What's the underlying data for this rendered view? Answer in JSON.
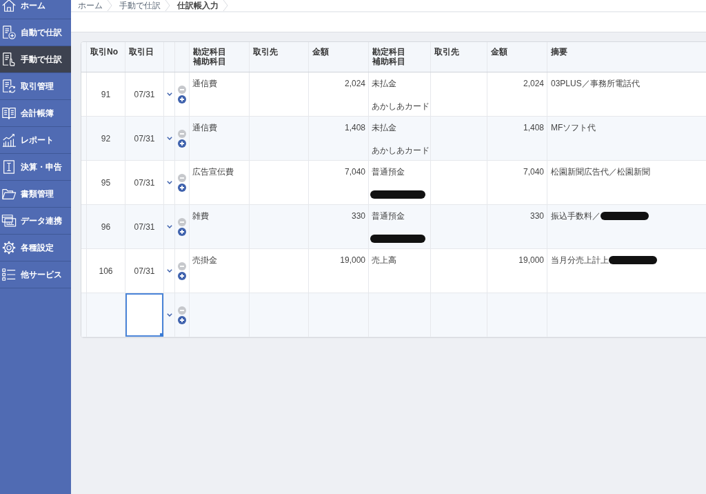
{
  "sidebar": {
    "items": [
      {
        "label": "ホーム",
        "selected": false
      },
      {
        "label": "自動で仕訳",
        "selected": false
      },
      {
        "label": "手動で仕訳",
        "selected": true
      },
      {
        "label": "取引管理",
        "selected": false
      },
      {
        "label": "会計帳簿",
        "selected": false
      },
      {
        "label": "レポート",
        "selected": false
      },
      {
        "label": "決算・申告",
        "selected": false
      },
      {
        "label": "書類管理",
        "selected": false
      },
      {
        "label": "データ連携",
        "selected": false
      },
      {
        "label": "各種設定",
        "selected": false
      },
      {
        "label": "他サービス",
        "selected": false
      }
    ]
  },
  "breadcrumb": [
    {
      "label": "ホーム",
      "current": false
    },
    {
      "label": "手動で仕訳",
      "current": false
    },
    {
      "label": "仕訳帳入力",
      "current": true
    }
  ],
  "table": {
    "columns": [
      {
        "label": "取引No"
      },
      {
        "label": "取引日"
      },
      {
        "label": "勘定科目",
        "sublabel": "補助科目"
      },
      {
        "label": "取引先"
      },
      {
        "label": "金額"
      },
      {
        "label": "勘定科目",
        "sublabel": "補助科目"
      },
      {
        "label": "取引先"
      },
      {
        "label": "金額"
      },
      {
        "label": "摘要"
      }
    ],
    "rows": [
      {
        "kind": "entry",
        "no": "91",
        "date": "07/31",
        "remove_disabled": true,
        "debit": {
          "account": "通信費",
          "amount": "2,024"
        },
        "credit": {
          "account": "未払金",
          "sub": "あかしあカード",
          "sub_redacted": false,
          "amount": "2,024"
        },
        "memo": {
          "text": "03PLUS／事務所電話代",
          "redacted": false
        }
      },
      {
        "kind": "entry",
        "no": "92",
        "date": "07/31",
        "remove_disabled": true,
        "debit": {
          "account": "通信費",
          "amount": "1,408"
        },
        "credit": {
          "account": "未払金",
          "sub": "あかしあカード",
          "sub_redacted": false,
          "amount": "1,408"
        },
        "memo": {
          "text": "MFソフト代",
          "redacted": false
        }
      },
      {
        "kind": "entry",
        "no": "95",
        "date": "07/31",
        "remove_disabled": true,
        "debit": {
          "account": "広告宣伝費",
          "amount": "7,040"
        },
        "credit": {
          "account": "普通預金",
          "sub_redacted": true,
          "amount": "7,040"
        },
        "memo": {
          "text": "松園新聞広告代／松園新聞",
          "redacted": false
        }
      },
      {
        "kind": "entry",
        "no": "96",
        "date": "07/31",
        "remove_disabled": true,
        "debit": {
          "account": "雑費",
          "amount": "330"
        },
        "credit": {
          "account": "普通預金",
          "sub_redacted": true,
          "amount": "330"
        },
        "memo": {
          "text": "振込手数料／",
          "redacted": true
        }
      },
      {
        "kind": "entry",
        "no": "106",
        "date": "07/31",
        "remove_disabled": true,
        "debit": {
          "account": "売掛金",
          "amount": "19,000"
        },
        "credit": {
          "account": "売上高",
          "sub_redacted": false,
          "amount": "19,000"
        },
        "memo": {
          "text": "当月分売上計上",
          "redacted": true
        }
      },
      {
        "kind": "blank",
        "date_focused": true,
        "remove_disabled": true
      }
    ]
  }
}
